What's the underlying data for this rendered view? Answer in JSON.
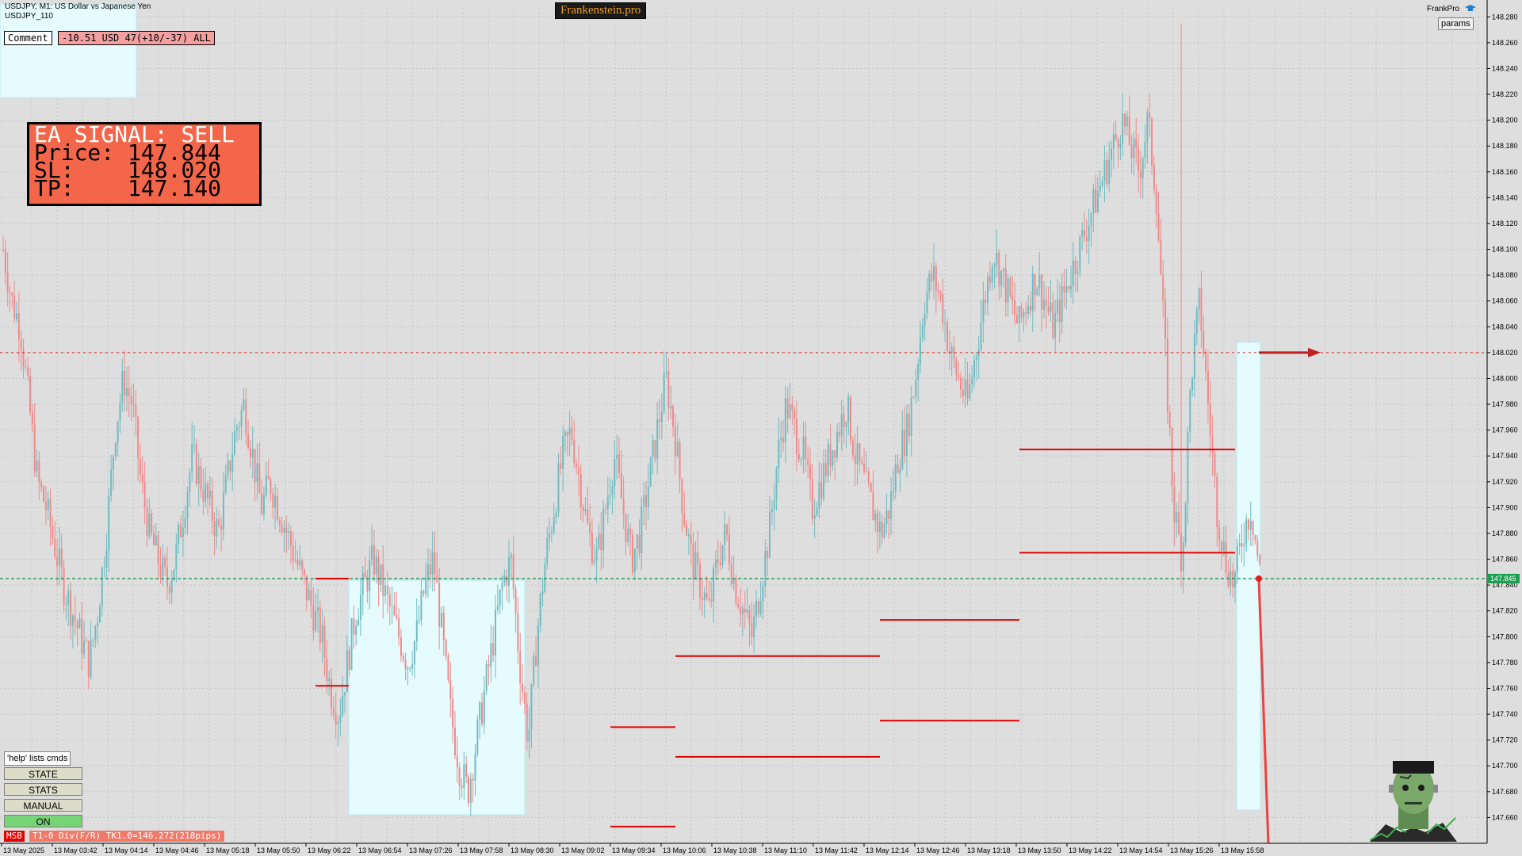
{
  "header": {
    "symbol_title": "USDJPY, M1:  US Dollar vs Japanese Yen",
    "subtitle": "USDJPY_110",
    "brand": "Frankenstein.pro",
    "frankpro_label": "FrankPro",
    "params_label": "params"
  },
  "comment": {
    "label": "Comment",
    "value": "-10.51 USD 47(+10/-37) ALL"
  },
  "signal": {
    "title": "EA SIGNAL: SELL",
    "price_line": "Price: 147.844",
    "sl_line": "SL:    148.020",
    "tp_line": "TP:    147.140",
    "bg_color": "#f4664a"
  },
  "buttons": {
    "help": "'help' lists cmds",
    "state": "STATE",
    "stats": "STATS",
    "manual": "MANUAL",
    "on": "ON"
  },
  "status": {
    "msb": "MSB",
    "info": "T1-0  Div(F/R) TK1.0=146.272(218pips)"
  },
  "chart_data": {
    "type": "candlestick",
    "symbol": "USDJPY",
    "timeframe": "M1",
    "colors": {
      "bull": "#6fbcc0",
      "bear": "#f08a8a",
      "background": "#dedede",
      "grid": "#c4c4c4"
    },
    "ylim": [
      147.64,
      148.29
    ],
    "y_ticks": [
      "147.660",
      "147.680",
      "147.700",
      "147.720",
      "147.740",
      "147.760",
      "147.780",
      "147.800",
      "147.820",
      "147.840",
      "147.860",
      "147.880",
      "147.900",
      "147.920",
      "147.940",
      "147.960",
      "147.980",
      "148.000",
      "148.020",
      "148.040",
      "148.060",
      "148.080",
      "148.100",
      "148.120",
      "148.140",
      "148.160",
      "148.180",
      "148.200",
      "148.220",
      "148.240",
      "148.260",
      "148.280"
    ],
    "x_ticks": [
      "13 May 2025",
      "13 May 03:42",
      "13 May 04:14",
      "13 May 04:46",
      "13 May 05:18",
      "13 May 05:50",
      "13 May 06:22",
      "13 May 06:54",
      "13 May 07:26",
      "13 May 07:58",
      "13 May 08:30",
      "13 May 09:02",
      "13 May 09:34",
      "13 May 10:06",
      "13 May 10:38",
      "13 May 11:10",
      "13 May 11:42",
      "13 May 12:14",
      "13 May 12:46",
      "13 May 13:18",
      "13 May 13:50",
      "13 May 14:22",
      "13 May 14:54",
      "13 May 15:26",
      "13 May 15:58"
    ],
    "current_price": "147.845",
    "sl_level": 148.02,
    "bid_level": 147.845,
    "price_path": [
      148.1,
      148.06,
      148.04,
      147.98,
      147.92,
      147.9,
      147.87,
      147.84,
      147.82,
      147.8,
      147.78,
      147.82,
      147.88,
      147.96,
      148.0,
      147.98,
      147.92,
      147.88,
      147.86,
      147.84,
      147.86,
      147.9,
      147.94,
      147.92,
      147.9,
      147.88,
      147.92,
      147.96,
      147.98,
      147.94,
      147.9,
      147.92,
      147.9,
      147.88,
      147.86,
      147.84,
      147.82,
      147.8,
      147.76,
      147.74,
      147.78,
      147.82,
      147.84,
      147.86,
      147.84,
      147.82,
      147.8,
      147.78,
      147.8,
      147.84,
      147.86,
      147.8,
      147.74,
      147.7,
      147.68,
      147.72,
      147.76,
      147.8,
      147.84,
      147.86,
      147.78,
      147.72,
      147.8,
      147.86,
      147.9,
      147.94,
      147.96,
      147.92,
      147.88,
      147.86,
      147.9,
      147.94,
      147.9,
      147.86,
      147.88,
      147.92,
      147.96,
      148.0,
      147.96,
      147.9,
      147.86,
      147.84,
      147.82,
      147.86,
      147.88,
      147.84,
      147.82,
      147.8,
      147.84,
      147.88,
      147.94,
      147.98,
      147.96,
      147.94,
      147.9,
      147.92,
      147.94,
      147.96,
      147.98,
      147.94,
      147.92,
      147.9,
      147.88,
      147.9,
      147.94,
      147.96,
      148.0,
      148.06,
      148.08,
      148.06,
      148.02,
      148.0,
      147.98,
      148.02,
      148.06,
      148.1,
      148.08,
      148.06,
      148.04,
      148.06,
      148.08,
      148.06,
      148.04,
      148.06,
      148.08,
      148.1,
      148.12,
      148.14,
      148.16,
      148.18,
      148.2,
      148.18,
      148.16,
      148.2,
      148.14,
      148.02,
      147.9,
      147.86,
      148.0,
      148.06,
      147.98,
      147.9,
      147.86,
      147.84,
      147.88,
      147.9,
      147.85
    ]
  },
  "annotations": {
    "horizontal_levels": [
      {
        "price": 147.845,
        "from": "13 May 06:22",
        "to": "13 May 06:54",
        "color": "#e00000"
      },
      {
        "price": 147.762,
        "from": "13 May 06:22",
        "to": "13 May 06:54",
        "color": "#e00000"
      },
      {
        "price": 147.73,
        "from": "13 May 09:02",
        "to": "13 May 09:34",
        "color": "#e00000"
      },
      {
        "price": 147.653,
        "from": "13 May 09:02",
        "to": "13 May 09:34",
        "color": "#e00000"
      },
      {
        "price": 147.785,
        "from": "13 May 09:34",
        "to": "13 May 11:42",
        "color": "#e00000"
      },
      {
        "price": 147.707,
        "from": "13 May 09:34",
        "to": "13 May 11:42",
        "color": "#e00000"
      },
      {
        "price": 147.813,
        "from": "13 May 11:42",
        "to": "13 May 13:18",
        "color": "#e00000"
      },
      {
        "price": 147.735,
        "from": "13 May 11:42",
        "to": "13 May 13:18",
        "color": "#e00000"
      },
      {
        "price": 147.945,
        "from": "13 May 13:18",
        "to": "13 May 15:26",
        "color": "#e00000"
      },
      {
        "price": 147.865,
        "from": "13 May 13:18",
        "to": "13 May 15:26",
        "color": "#e00000"
      }
    ]
  }
}
